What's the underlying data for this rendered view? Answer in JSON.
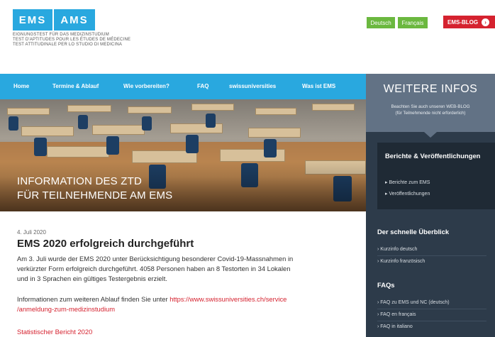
{
  "header": {
    "logo_left": "EMS",
    "logo_right": "AMS",
    "sublines": [
      "EIGNUNGSTEST FÜR DAS MEDIZINSTUDIUM",
      "TEST D'APTITUDES POUR LES ÉTUDES DE MÉDECINE",
      "TEST ATTITUDINALE PER LO STUDIO DI MEDICINA"
    ],
    "lang_de": "Deutsch",
    "lang_fr": "Français",
    "blog": "EMS-BLOG",
    "blog_arrow": "›"
  },
  "nav": {
    "items": [
      "Home",
      "Termine & Ablauf",
      "Wie vorbereiten?",
      "FAQ",
      "swissuniversities",
      "Was ist EMS"
    ]
  },
  "hero": {
    "line1": "INFORMATION DES ZTD",
    "line2": "FÜR TEILNEHMENDE AM EMS"
  },
  "article": {
    "date": "4. Juli 2020",
    "title": "EMS 2020 erfolgreich durchgeführt",
    "p1": [
      "Am 3. Juli wurde der EMS 2020 unter Berücksichtigung besonderer Covid-19-Massnahmen in",
      "verkürzter Form erfolgreich durchgeführt. 4058 Personen haben an 8 Testorten in 34 Lokalen",
      "und in 3 Sprachen ein gültiges Testergebnis erzielt."
    ],
    "p2_prefix": "Informationen zum weiteren Ablauf finden Sie unter ",
    "p2_link1": "https://www.swissuniversities.ch/service",
    "p2_link2": "/anmeldung-zum-medizinstudium",
    "report_link": "Statistischer Bericht 2020"
  },
  "sidebar": {
    "title": "WEITERE INFOS",
    "text1": "Beachten Sie auch unseren WEB-BLOG",
    "text2": "(für Teilnehmende nicht erforderlich)",
    "berichte_title": "Berichte & Veröffentlichungen",
    "berichte_links": [
      "Berichte zum EMS",
      "Veröffentlichungen"
    ],
    "ueberblick_title": "Der schnelle Überblick",
    "ueberblick_links": [
      "Kurzinfo deutsch",
      "Kurzinfo französisch"
    ],
    "faq_title": "FAQs",
    "faq_links": [
      "FAQ zu EMS und NC (deutsch)",
      "FAQ en français",
      "FAQ in italiano"
    ]
  },
  "colors": {
    "brand_blue": "#29a8df",
    "lang_green": "#6bb83f",
    "blog_red": "#d5222f",
    "sidebar_dark": "#2d3b4a"
  }
}
